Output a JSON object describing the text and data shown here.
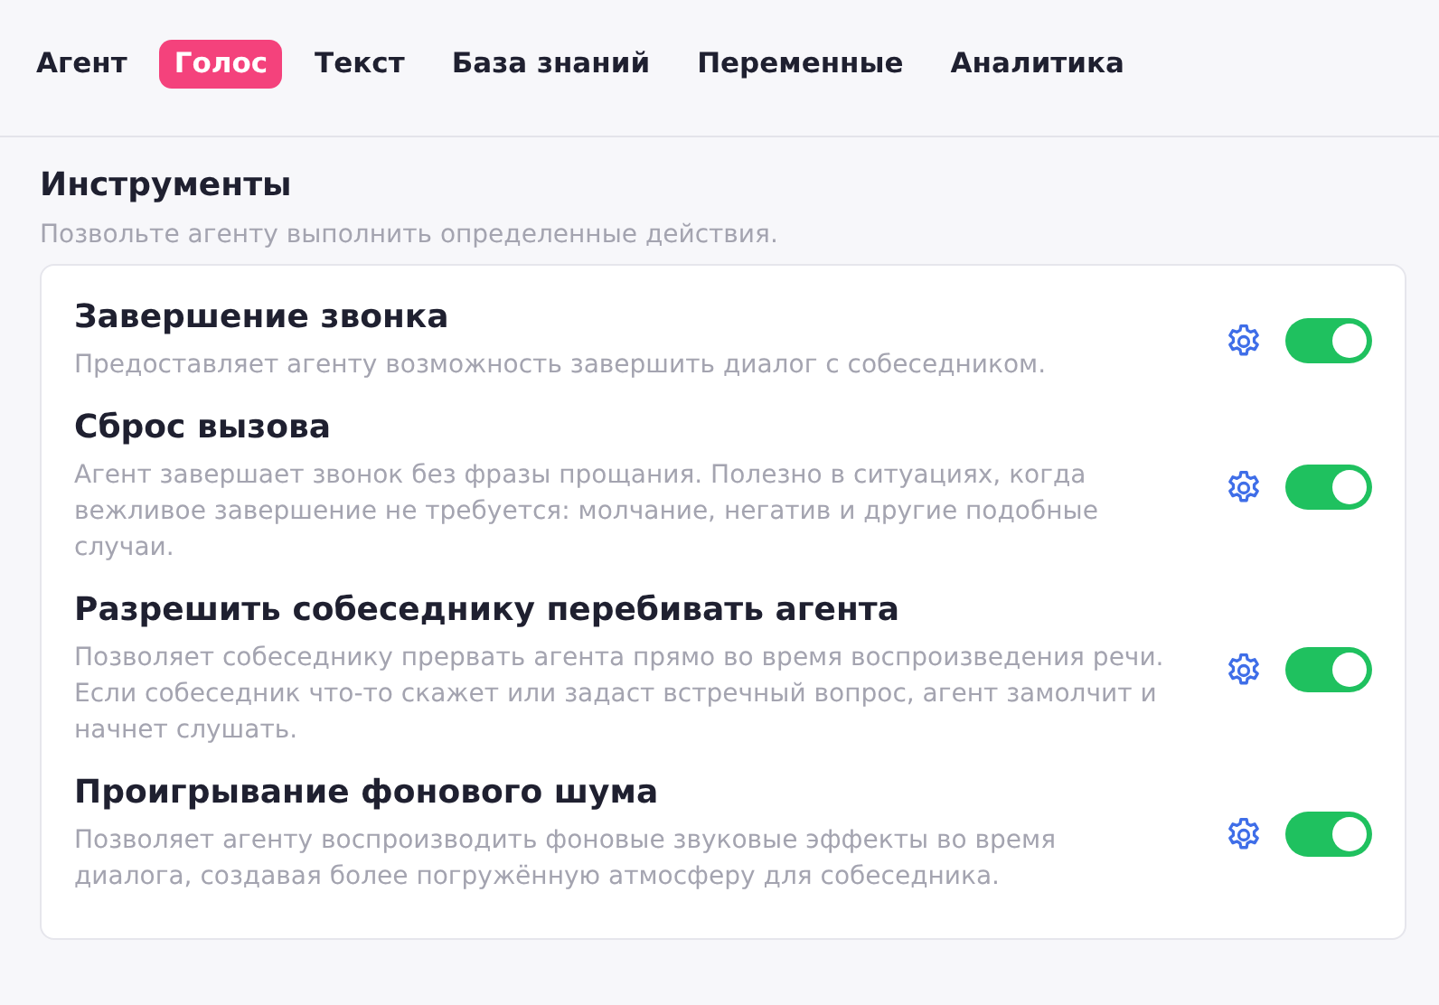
{
  "tabs": [
    {
      "label": "Агент",
      "selected": false
    },
    {
      "label": "Голос",
      "selected": true
    },
    {
      "label": "Текст",
      "selected": false
    },
    {
      "label": "База знаний",
      "selected": false
    },
    {
      "label": "Переменные",
      "selected": false
    },
    {
      "label": "Аналитика",
      "selected": false
    }
  ],
  "section": {
    "title": "Инструменты",
    "subtitle": "Позвольте агенту выполнить определенные действия."
  },
  "tools": [
    {
      "title": "Завершение звонка",
      "description": "Предоставляет агенту возможность завершить диалог с собеседником.",
      "on": true
    },
    {
      "title": "Сброс вызова",
      "description": "Агент завершает звонок без фразы прощания. Полезно в ситуациях, когда вежливое завершение не требуется: молчание, негатив и другие подобные случаи.",
      "on": true
    },
    {
      "title": "Разрешить собеседнику перебивать агента",
      "description": "Позволяет собеседнику прервать агента прямо во время воспроизведения речи. Если собеседник что-то скажет или задаст встречный вопрос, агент замолчит и начнет слушать.",
      "on": true
    },
    {
      "title": "Проигрывание фонового шума",
      "description": "Позволяет агенту воспроизводить фоновые звуковые эффекты во время диалога, создавая более погружённую атмосферу для собеседника.",
      "on": true
    }
  ]
}
